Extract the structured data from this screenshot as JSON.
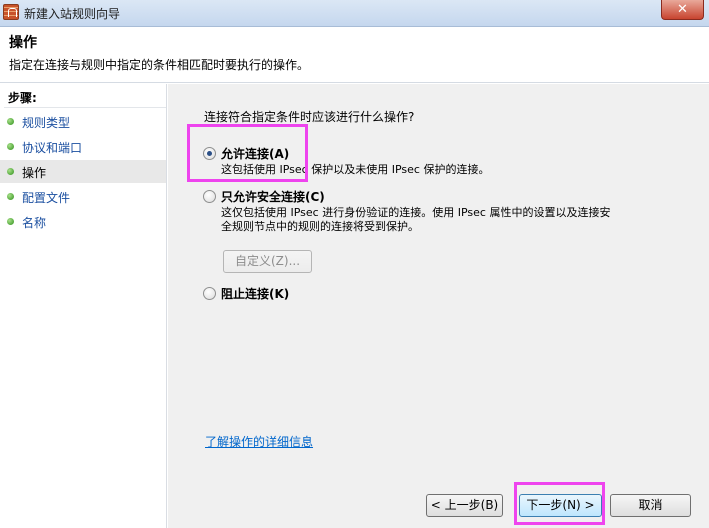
{
  "window": {
    "title": "新建入站规则向导",
    "close_glyph": "✕"
  },
  "header": {
    "title": "操作",
    "description": "指定在连接与规则中指定的条件相匹配时要执行的操作。"
  },
  "sidebar": {
    "steps_label": "步骤:",
    "steps": [
      {
        "label": "规则类型",
        "active": false
      },
      {
        "label": "协议和端口",
        "active": false
      },
      {
        "label": "操作",
        "active": true
      },
      {
        "label": "配置文件",
        "active": false
      },
      {
        "label": "名称",
        "active": false
      }
    ]
  },
  "main": {
    "question": "连接符合指定条件时应该进行什么操作?",
    "options": {
      "allow": {
        "label": "允许连接(A)",
        "description": "这包括使用 IPsec 保护以及未使用 IPsec 保护的连接。",
        "selected": true
      },
      "allow_secure": {
        "label": "只允许安全连接(C)",
        "description_line1": "这仅包括使用 IPsec 进行身份验证的连接。使用 IPsec 属性中的设置以及连接安",
        "description_line2": "全规则节点中的规则的连接将受到保护。",
        "selected": false,
        "customize_button": "自定义(Z)..."
      },
      "block": {
        "label": "阻止连接(K)",
        "selected": false
      }
    },
    "learn_more_link": "了解操作的详细信息"
  },
  "footer": {
    "back_button": "< 上一步(B)",
    "next_button": "下一步(N) >",
    "cancel_button": "取消"
  },
  "colors": {
    "highlight": "#ee44ee",
    "link": "#0066cc",
    "step_dot": "#2e8f1a"
  }
}
